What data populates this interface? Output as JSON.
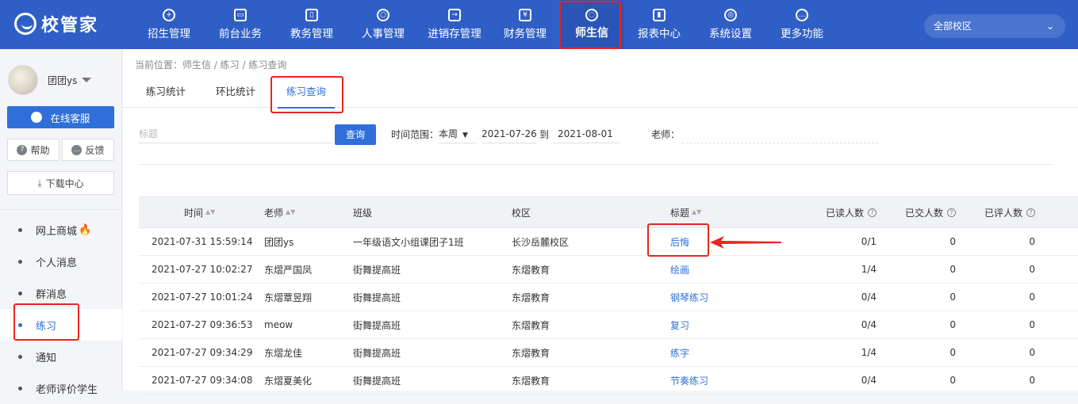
{
  "app": {
    "logo_text": "校管家"
  },
  "nav": [
    {
      "label": "招生管理",
      "icon": "user-plus-icon",
      "glyph": "+"
    },
    {
      "label": "前台业务",
      "icon": "monitor-icon",
      "glyph": "▭"
    },
    {
      "label": "教务管理",
      "icon": "book-icon",
      "glyph": "▯"
    },
    {
      "label": "人事管理",
      "icon": "person-icon",
      "glyph": "○"
    },
    {
      "label": "进销存管理",
      "icon": "inventory-icon",
      "glyph": "→"
    },
    {
      "label": "财务管理",
      "icon": "yuan-icon",
      "glyph": "¥"
    },
    {
      "label": "师生信",
      "icon": "message-icon",
      "glyph": "◌"
    },
    {
      "label": "报表中心",
      "icon": "chart-icon",
      "glyph": "▮"
    },
    {
      "label": "系统设置",
      "icon": "settings-icon",
      "glyph": "◎"
    },
    {
      "label": "更多功能",
      "icon": "more-icon",
      "glyph": "…"
    }
  ],
  "campus_select": {
    "value": "全部校区"
  },
  "sidebar": {
    "username": "团团ys",
    "service_btn": "在线客服",
    "help_btn": "帮助",
    "feedback_btn": "反馈",
    "download_btn": "下载中心",
    "menu": [
      {
        "label": "网上商城",
        "hot": "🔥"
      },
      {
        "label": "个人消息"
      },
      {
        "label": "群消息"
      },
      {
        "label": "练习"
      },
      {
        "label": "通知"
      },
      {
        "label": "老师评价学生"
      }
    ]
  },
  "breadcrumb": "当前位置：师生信 / 练习 / 练习查询",
  "tabs": [
    "练习统计",
    "环比统计",
    "练习查询"
  ],
  "filters": {
    "title_placeholder": "标题",
    "search_btn": "查询",
    "time_range_label": "时间范围：",
    "time_range_value": "本周",
    "date_start": "2021-07-26",
    "date_sep": "到",
    "date_end": "2021-08-01",
    "teacher_label": "老师："
  },
  "table": {
    "headers": {
      "time": "时间",
      "teacher": "老师",
      "class": "班级",
      "campus": "校区",
      "title": "标题",
      "read": "已读人数",
      "submitted": "已交人数",
      "evaluated": "已评人数"
    },
    "rows": [
      {
        "time": "2021-07-31 15:59:14",
        "teacher": "团团ys",
        "class": "一年级语文小组课团子1班",
        "campus": "长沙岳麓校区",
        "title": "后悔",
        "read": "0/1",
        "submitted": "0",
        "evaluated": "0"
      },
      {
        "time": "2021-07-27 10:02:27",
        "teacher": "东熠严国凤",
        "class": "街舞提高班",
        "campus": "东熠教育",
        "title": "绘画",
        "read": "1/4",
        "submitted": "0",
        "evaluated": "0"
      },
      {
        "time": "2021-07-27 10:01:24",
        "teacher": "东熠覃昱翔",
        "class": "街舞提高班",
        "campus": "东熠教育",
        "title": "钢琴练习",
        "read": "0/4",
        "submitted": "0",
        "evaluated": "0"
      },
      {
        "time": "2021-07-27 09:36:53",
        "teacher": "meow",
        "class": "街舞提高班",
        "campus": "东熠教育",
        "title": "复习",
        "read": "0/4",
        "submitted": "0",
        "evaluated": "0"
      },
      {
        "time": "2021-07-27 09:34:29",
        "teacher": "东熠龙佳",
        "class": "街舞提高班",
        "campus": "东熠教育",
        "title": "练字",
        "read": "1/4",
        "submitted": "0",
        "evaluated": "0"
      },
      {
        "time": "2021-07-27 09:34:08",
        "teacher": "东熠夏美化",
        "class": "街舞提高班",
        "campus": "东熠教育",
        "title": "节奏练习",
        "read": "0/4",
        "submitted": "0",
        "evaluated": "0"
      }
    ]
  },
  "colors": {
    "primary": "#2f5fc6",
    "accent": "#2f6fd9",
    "annotation": "#e8251f"
  }
}
